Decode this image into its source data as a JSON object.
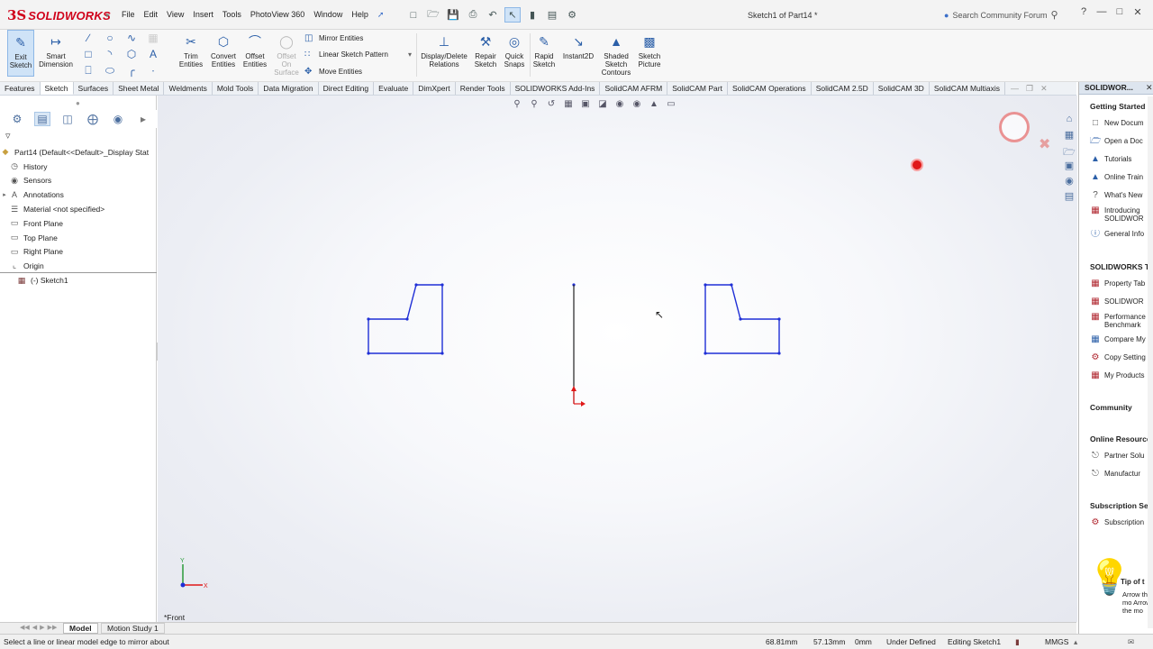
{
  "app": {
    "logo_ds": "3S",
    "logo_text": "SOLIDWORKS",
    "document_title": "Sketch1 of Part14 *"
  },
  "menu": [
    "File",
    "Edit",
    "View",
    "Insert",
    "Tools",
    "PhotoView 360",
    "Window",
    "Help"
  ],
  "search": {
    "placeholder": "Search Community Forum"
  },
  "ribbon": {
    "exit_sketch": "Exit Sketch",
    "smart_dimension": "Smart Dimension",
    "trim_entities": "Trim Entities",
    "convert_entities": "Convert Entities",
    "offset_entities": "Offset Entities",
    "offset_on_surface": "Offset On Surface",
    "mirror_entities": "Mirror Entities",
    "linear_sketch_pattern": "Linear Sketch Pattern",
    "move_entities": "Move Entities",
    "display_delete_relations": "Display/Delete Relations",
    "repair_sketch": "Repair Sketch",
    "quick_snaps": "Quick Snaps",
    "rapid_sketch": "Rapid Sketch",
    "instant2d": "Instant2D",
    "shaded_sketch_contours": "Shaded Sketch Contours",
    "sketch_picture": "Sketch Picture"
  },
  "tabs": [
    "Features",
    "Sketch",
    "Surfaces",
    "Sheet Metal",
    "Weldments",
    "Mold Tools",
    "Data Migration",
    "Direct Editing",
    "Evaluate",
    "DimXpert",
    "Render Tools",
    "SOLIDWORKS Add-Ins",
    "SolidCAM AFRM",
    "SolidCAM Part",
    "SolidCAM Operations",
    "SolidCAM 2.5D",
    "SolidCAM 3D",
    "SolidCAM Multiaxis"
  ],
  "active_tab": "Sketch",
  "tree": {
    "root": "Part14  (Default<<Default>_Display Stat",
    "items": [
      "History",
      "Sensors",
      "Annotations",
      "Material <not specified>",
      "Front Plane",
      "Top Plane",
      "Right Plane",
      "Origin",
      "(-) Sketch1"
    ]
  },
  "viewport": {
    "view_label": "*Front"
  },
  "bottom_tabs": {
    "model": "Model",
    "motion": "Motion Study 1"
  },
  "status": {
    "message": "Select a line or linear model edge to mirror about",
    "x": "68.81mm",
    "y": "57.13mm",
    "z": "0mm",
    "state": "Under Defined",
    "editing": "Editing Sketch1",
    "units": "MMGS"
  },
  "taskpane": {
    "header": "SOLIDWOR...",
    "getting_started": "Getting Started",
    "gs_items": [
      "New Docum",
      "Open a Doc",
      "Tutorials",
      "Online Train",
      "What's New",
      "Introducing SOLIDWOR",
      "General Info"
    ],
    "tools_title": "SOLIDWORKS To",
    "tools_items": [
      "Property Tab",
      "SOLIDWOR",
      "Performance Benchmark",
      "Compare My",
      "Copy Setting",
      "My Products"
    ],
    "community": "Community",
    "online_resources": "Online Resource",
    "or_items": [
      "Partner Solu",
      "Manufactur"
    ],
    "subscription_title": "Subscription Ser",
    "subscription_items": [
      "Subscription"
    ],
    "tip_title": "Tip of t",
    "tip_body": "Arrow the mo Arrow the mo"
  },
  "colors": {
    "sketch": "#1f2fd6",
    "accent": "#2b5fa8",
    "brand": "#d0021b",
    "origin": "#e01818"
  }
}
